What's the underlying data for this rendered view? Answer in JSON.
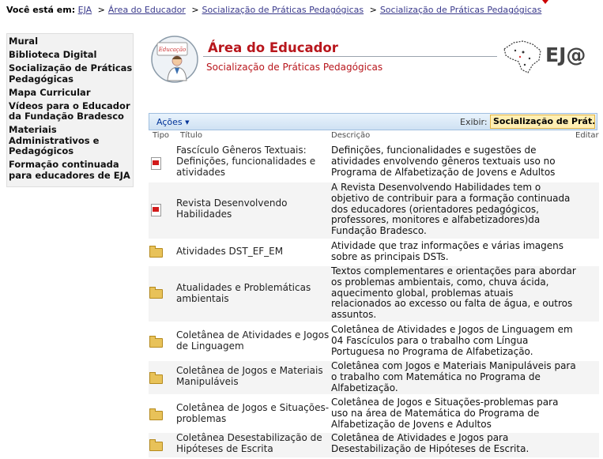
{
  "breadcrumb": {
    "label": "Você está em:",
    "sep": ">",
    "links": [
      "EJA",
      "Área do Educador",
      "Socialização de Práticas Pedagógicas",
      "Socialização de Práticas Pedagógicas"
    ]
  },
  "nav": {
    "items": [
      "Mural",
      "Biblioteca Digital",
      "Socialização de Práticas Pedagógicas",
      "Mapa Curricular",
      "Vídeos para o Educador da Fundação Bradesco",
      "Materiais Administrativos e Pedagógicos",
      "Formação continuada para educadores de EJA"
    ]
  },
  "header": {
    "icon_caption": "Educação",
    "title": "Área do Educador",
    "subtitle": "Socialização de Práticas Pedagógicas",
    "logo_text": "EJ@"
  },
  "toolbar": {
    "actions_label": "Ações",
    "view_label": "Exibir:",
    "view_value": "Socialização de Prát..."
  },
  "columns": {
    "type": "Tipo",
    "title": "Título",
    "description": "Descrição",
    "edit": "Editar"
  },
  "rows": [
    {
      "type": "pdf",
      "title": "Fascículo Gêneros Textuais: Definições, funcionalidades e atividades",
      "description": "Definições, funcionalidades e sugestões de atividades envolvendo gêneros textuais uso no Programa de Alfabetização de Jovens e Adultos"
    },
    {
      "type": "pdf",
      "title": "Revista Desenvolvendo Habilidades",
      "description": "A Revista Desenvolvendo Habilidades tem o objetivo de contribuir para a formação continuada dos educadores (orientadores pedagógicos, professores, monitores e alfabetizadores)da Fundação Bradesco."
    },
    {
      "type": "folder",
      "title": "Atividades DST_EF_EM",
      "description": "Atividade que traz informações e várias imagens sobre as principais DSTs."
    },
    {
      "type": "folder",
      "title": "Atualidades e Problemáticas ambientais",
      "description": "Textos complementares e orientações para abordar os problemas ambientais, como, chuva ácida, aquecimento global, problemas atuais relacionados ao excesso ou falta de água, e outros assuntos."
    },
    {
      "type": "folder",
      "title": "Coletânea de Atividades e Jogos de Linguagem",
      "description": "Coletânea  de Atividades e Jogos de Linguagem em 04 Fascículos para o trabalho com Língua Portuguesa no Programa de Alfabetização."
    },
    {
      "type": "folder",
      "title": "Coletânea de Jogos e Materiais Manipuláveis",
      "description": "Coletânea com Jogos e Materiais Manipuláveis para o trabalho com Matemática no Programa de Alfabetização."
    },
    {
      "type": "folder",
      "title": "Coletânea de Jogos e Situações-problemas",
      "description": "Coletânea de Jogos e Situações-problemas para uso na área de Matemática do Programa de Alfabetização de Jovens e Adultos"
    },
    {
      "type": "folder",
      "title": "Coletânea Desestabilização de Hipóteses de Escrita",
      "description": "Coletânea de Atividades e Jogos para Desestabilização de Hipóteses de Escrita."
    }
  ],
  "icons": {
    "pdf": "pdf-file-icon",
    "folder": "folder-icon",
    "dropdown": "chevron-down-icon"
  },
  "colors": {
    "title_red": "#b8161c",
    "link_blue": "#3a3a8c",
    "toolbar_blue": "#cfe1f3",
    "view_highlight": "#ffefb3"
  }
}
